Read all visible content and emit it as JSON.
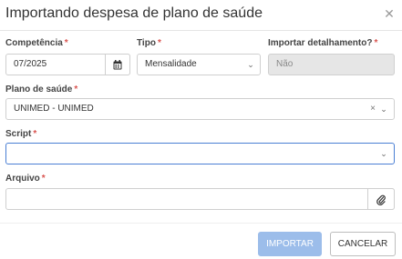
{
  "dialog": {
    "title": "Importando despesa de plano de saúde",
    "close_glyph": "✕"
  },
  "fields": {
    "competencia": {
      "label": "Competência",
      "required": "*",
      "value": "07/2025",
      "icon": "calendar-icon"
    },
    "tipo": {
      "label": "Tipo",
      "required": "*",
      "value": "Mensalidade",
      "icon": "chevron-down-icon"
    },
    "importar_detalhamento": {
      "label": "Importar detalhamento?",
      "required": "*",
      "value": "Não"
    },
    "plano_saude": {
      "label": "Plano de saúde",
      "required": "*",
      "value": "UNIMED - UNIMED",
      "clear_glyph": "×",
      "icon": "chevron-down-icon"
    },
    "script": {
      "label": "Script",
      "required": "*",
      "value": "",
      "icon": "chevron-down-icon"
    },
    "arquivo": {
      "label": "Arquivo",
      "required": "*",
      "value": "",
      "icon": "paperclip-icon"
    }
  },
  "chevron_glyph": "⌄",
  "buttons": {
    "importar": "IMPORTAR",
    "cancelar": "CANCELAR"
  },
  "colors": {
    "required": "#d9534f",
    "primary_disabled": "#9cbdea",
    "focus_border": "#4a7fd4",
    "disabled_field": "#e6e6e6"
  }
}
